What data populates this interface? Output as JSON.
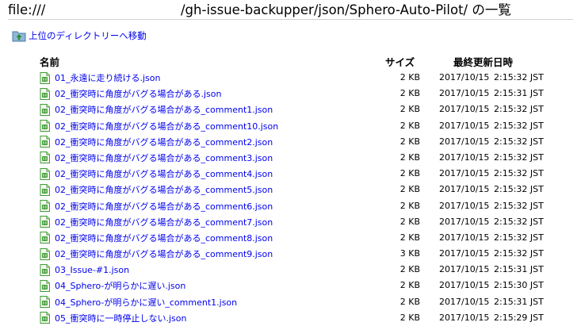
{
  "header": {
    "prefix": "file:///",
    "path": "/gh-issue-backupper/json/Sphero-Auto-Pilot/ の一覧"
  },
  "up_link": {
    "label": "上位のディレクトリーへ移動",
    "icon": "folder-up-icon"
  },
  "columns": {
    "name": "名前",
    "size": "サイズ",
    "modified": "最終更新日時"
  },
  "files": [
    {
      "name": "01_永遠に走り続ける.json",
      "size": "2 KB",
      "date": "2017/10/15",
      "time": "2:15:32 JST"
    },
    {
      "name": "02_衝突時に角度がバグる場合がある.json",
      "size": "2 KB",
      "date": "2017/10/15",
      "time": "2:15:31 JST"
    },
    {
      "name": "02_衝突時に角度がバグる場合がある_comment1.json",
      "size": "2 KB",
      "date": "2017/10/15",
      "time": "2:15:32 JST"
    },
    {
      "name": "02_衝突時に角度がバグる場合がある_comment10.json",
      "size": "2 KB",
      "date": "2017/10/15",
      "time": "2:15:32 JST"
    },
    {
      "name": "02_衝突時に角度がバグる場合がある_comment2.json",
      "size": "2 KB",
      "date": "2017/10/15",
      "time": "2:15:32 JST"
    },
    {
      "name": "02_衝突時に角度がバグる場合がある_comment3.json",
      "size": "2 KB",
      "date": "2017/10/15",
      "time": "2:15:32 JST"
    },
    {
      "name": "02_衝突時に角度がバグる場合がある_comment4.json",
      "size": "2 KB",
      "date": "2017/10/15",
      "time": "2:15:32 JST"
    },
    {
      "name": "02_衝突時に角度がバグる場合がある_comment5.json",
      "size": "2 KB",
      "date": "2017/10/15",
      "time": "2:15:32 JST"
    },
    {
      "name": "02_衝突時に角度がバグる場合がある_comment6.json",
      "size": "2 KB",
      "date": "2017/10/15",
      "time": "2:15:32 JST"
    },
    {
      "name": "02_衝突時に角度がバグる場合がある_comment7.json",
      "size": "2 KB",
      "date": "2017/10/15",
      "time": "2:15:32 JST"
    },
    {
      "name": "02_衝突時に角度がバグる場合がある_comment8.json",
      "size": "2 KB",
      "date": "2017/10/15",
      "time": "2:15:32 JST"
    },
    {
      "name": "02_衝突時に角度がバグる場合がある_comment9.json",
      "size": "3 KB",
      "date": "2017/10/15",
      "time": "2:15:32 JST"
    },
    {
      "name": "03_Issue-#1.json",
      "size": "2 KB",
      "date": "2017/10/15",
      "time": "2:15:31 JST"
    },
    {
      "name": "04_Sphero-が明らかに遅い.json",
      "size": "2 KB",
      "date": "2017/10/15",
      "time": "2:15:30 JST"
    },
    {
      "name": "04_Sphero-が明らかに遅い_comment1.json",
      "size": "2 KB",
      "date": "2017/10/15",
      "time": "2:15:31 JST"
    },
    {
      "name": "05_衝突時に一時停止しない.json",
      "size": "2 KB",
      "date": "2017/10/15",
      "time": "2:15:29 JST"
    }
  ],
  "icons": {
    "file": "json-file-icon"
  },
  "colors": {
    "link": "#0000ee",
    "icon_green": "#3f9c35",
    "rule": "#d0d0d0"
  }
}
